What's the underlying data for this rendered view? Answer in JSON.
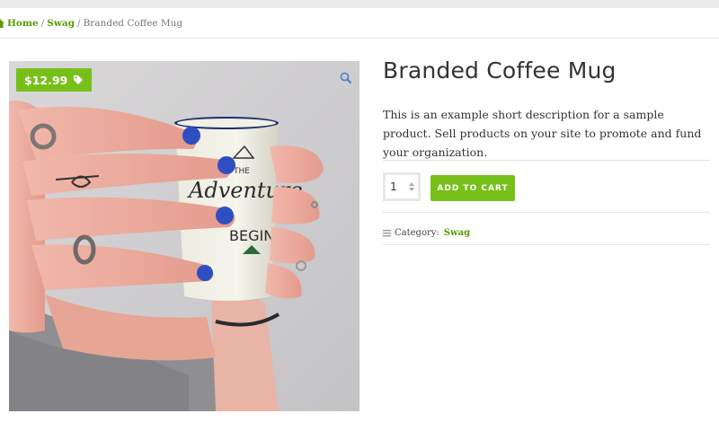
{
  "breadcrumb": {
    "home": "Home",
    "separator": "/",
    "category": "Swag",
    "current": "Branded Coffee Mug"
  },
  "product": {
    "price": "$12.99",
    "title": "Branded Coffee Mug",
    "description": "This is an example short description for a sample product. Sell products on your site to promote and fund your organization.",
    "quantity": "1",
    "add_to_cart_label": "ADD TO CART",
    "category_label": "Category:",
    "category": "Swag",
    "image_mug_text": [
      "THE",
      "Adventure",
      "BEGINS"
    ]
  },
  "icons": {
    "home": "home-icon",
    "price_tag": "tag-icon",
    "zoom": "magnifier-icon",
    "category": "folder-icon",
    "qty_stepper": "stepper-icon"
  },
  "colors": {
    "accent": "#77c01a",
    "link": "#5a9a00",
    "nail": "#2e4fc2"
  }
}
